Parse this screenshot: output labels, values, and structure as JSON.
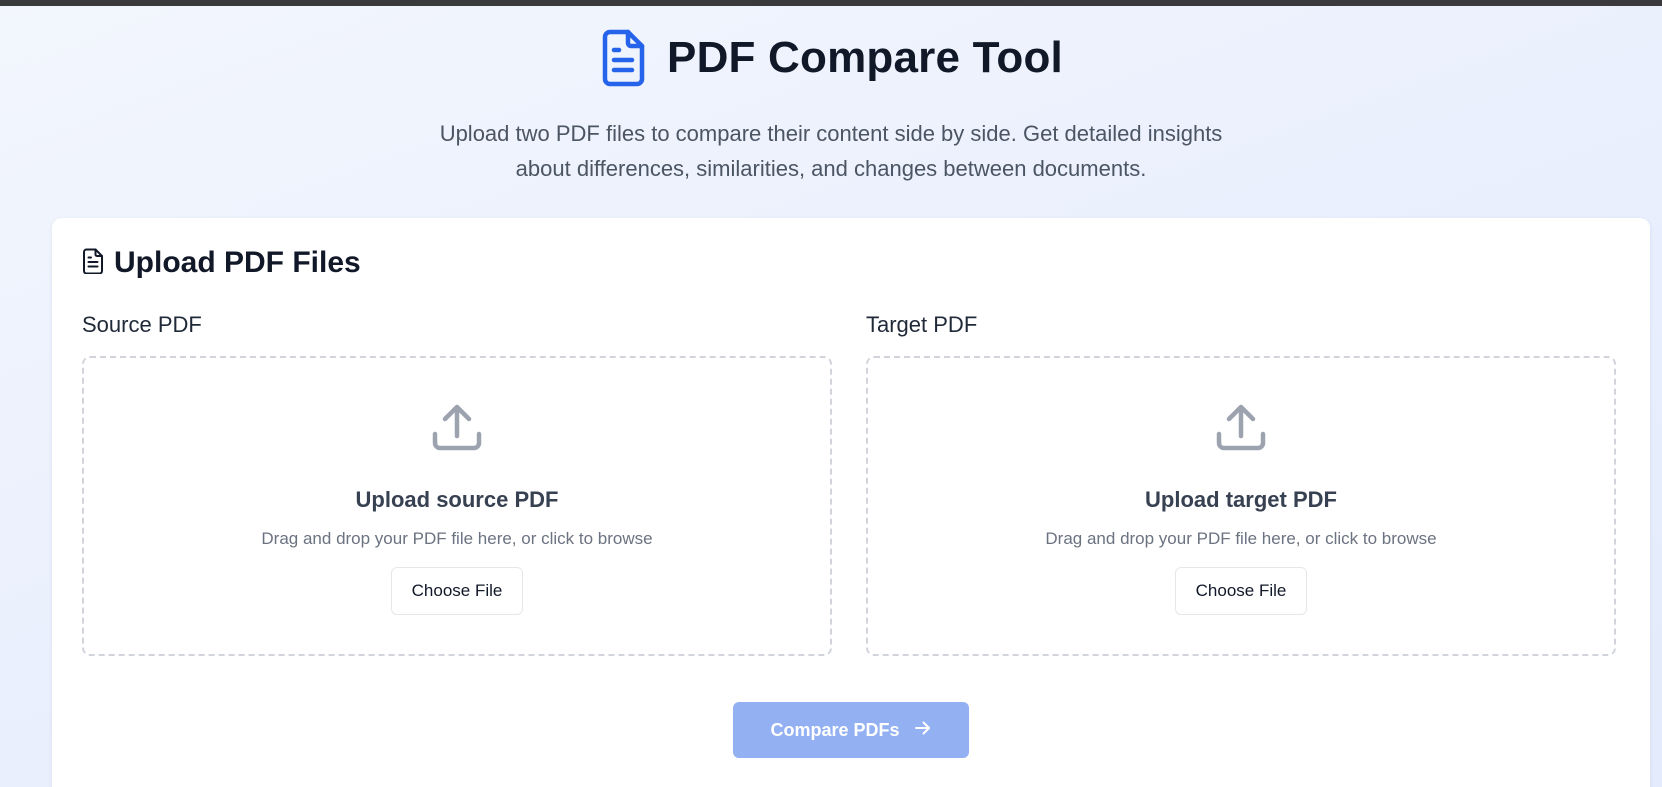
{
  "header": {
    "title": "PDF Compare Tool",
    "subtitle": "Upload two PDF files to compare their content side by side. Get detailed insights about differences, similarities, and changes between documents.",
    "icon": "file-text-icon"
  },
  "upload_card": {
    "title": "Upload PDF Files",
    "icon": "file-text-icon",
    "source": {
      "label": "Source PDF",
      "heading": "Upload source PDF",
      "hint": "Drag and drop your PDF file here, or click to browse",
      "button_label": "Choose File",
      "icon": "upload-icon"
    },
    "target": {
      "label": "Target PDF",
      "heading": "Upload target PDF",
      "hint": "Drag and drop your PDF file here, or click to browse",
      "button_label": "Choose File",
      "icon": "upload-icon"
    },
    "compare_button": {
      "label": "Compare PDFs",
      "icon": "arrow-right-icon",
      "enabled": false
    }
  },
  "colors": {
    "accent": "#2563eb",
    "compare_button_disabled": "#93b0f2",
    "heading_text": "#111827",
    "muted_text": "#6b7280"
  }
}
